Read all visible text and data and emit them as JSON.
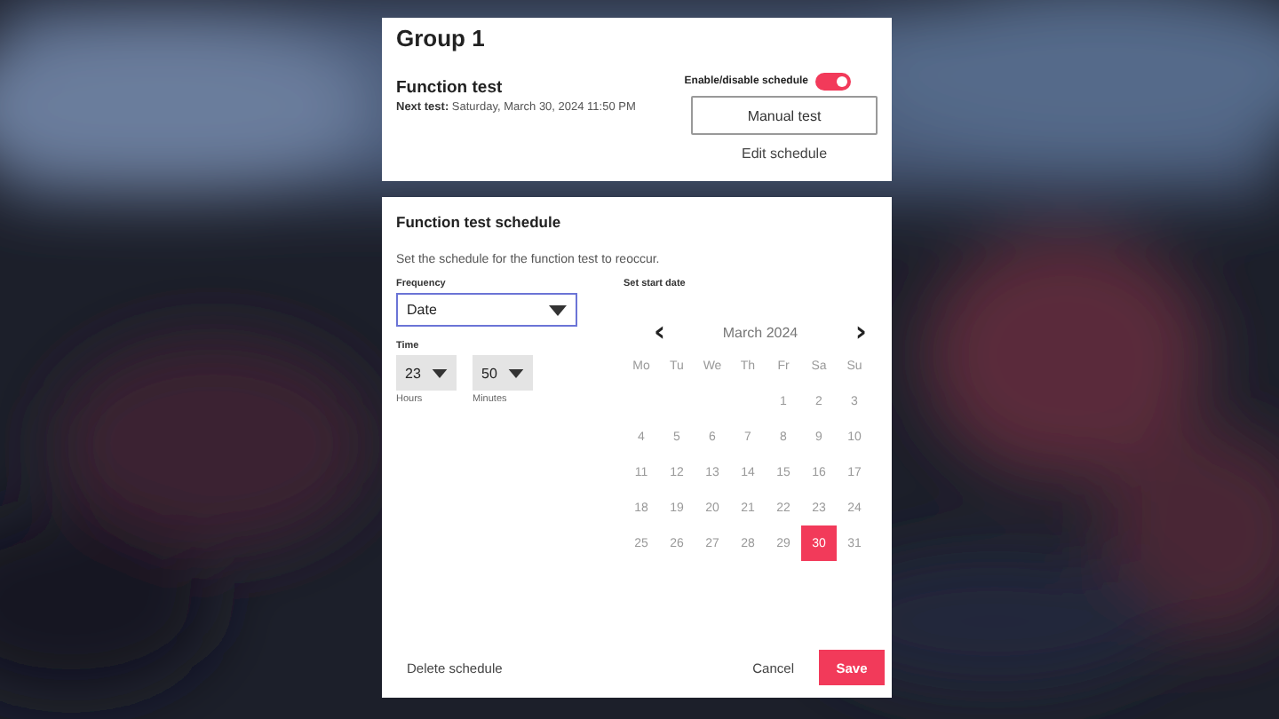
{
  "group": {
    "title": "Group 1",
    "test_name": "Function test",
    "next_label": "Next test:",
    "next_value": "Saturday, March 30, 2024 11:50 PM",
    "toggle_label": "Enable/disable schedule",
    "toggle_on": true,
    "manual_button": "Manual test",
    "edit_link": "Edit schedule"
  },
  "schedule": {
    "title": "Function test schedule",
    "description": "Set the schedule for the function test to reoccur.",
    "frequency": {
      "label": "Frequency",
      "value": "Date"
    },
    "time": {
      "label": "Time",
      "hours": {
        "value": "23",
        "label": "Hours"
      },
      "minutes": {
        "value": "50",
        "label": "Minutes"
      }
    },
    "calendar": {
      "label": "Set start date",
      "prev": "‹",
      "month": "March 2024",
      "next": "›",
      "weekdays": [
        "Mo",
        "Tu",
        "We",
        "Th",
        "Fr",
        "Sa",
        "Su"
      ],
      "weeks": [
        [
          {
            "day": "1",
            "selected": false
          },
          {
            "day": "2",
            "selected": false
          },
          {
            "day": "3",
            "selected": false
          }
        ],
        [
          {
            "day": "4",
            "selected": false
          },
          {
            "day": "5",
            "selected": false
          },
          {
            "day": "6",
            "selected": false
          },
          {
            "day": "7",
            "selected": false
          },
          {
            "day": "8",
            "selected": false
          },
          {
            "day": "9",
            "selected": false
          },
          {
            "day": "10",
            "selected": false
          }
        ],
        [
          {
            "day": "11",
            "selected": false
          },
          {
            "day": "12",
            "selected": false
          },
          {
            "day": "13",
            "selected": false
          },
          {
            "day": "14",
            "selected": false
          },
          {
            "day": "15",
            "selected": false
          },
          {
            "day": "16",
            "selected": false
          },
          {
            "day": "17",
            "selected": false
          }
        ],
        [
          {
            "day": "18",
            "selected": false
          },
          {
            "day": "19",
            "selected": false
          },
          {
            "day": "20",
            "selected": false
          },
          {
            "day": "21",
            "selected": false
          },
          {
            "day": "22",
            "selected": false
          },
          {
            "day": "23",
            "selected": false
          },
          {
            "day": "24",
            "selected": false
          }
        ],
        [
          {
            "day": "25",
            "selected": false
          },
          {
            "day": "26",
            "selected": false
          },
          {
            "day": "27",
            "selected": false
          },
          {
            "day": "28",
            "selected": false
          },
          {
            "day": "29",
            "selected": false
          },
          {
            "day": "30",
            "selected": true
          },
          {
            "day": "31",
            "selected": false
          }
        ]
      ]
    },
    "delete": "Delete schedule",
    "cancel": "Cancel",
    "save": "Save"
  }
}
